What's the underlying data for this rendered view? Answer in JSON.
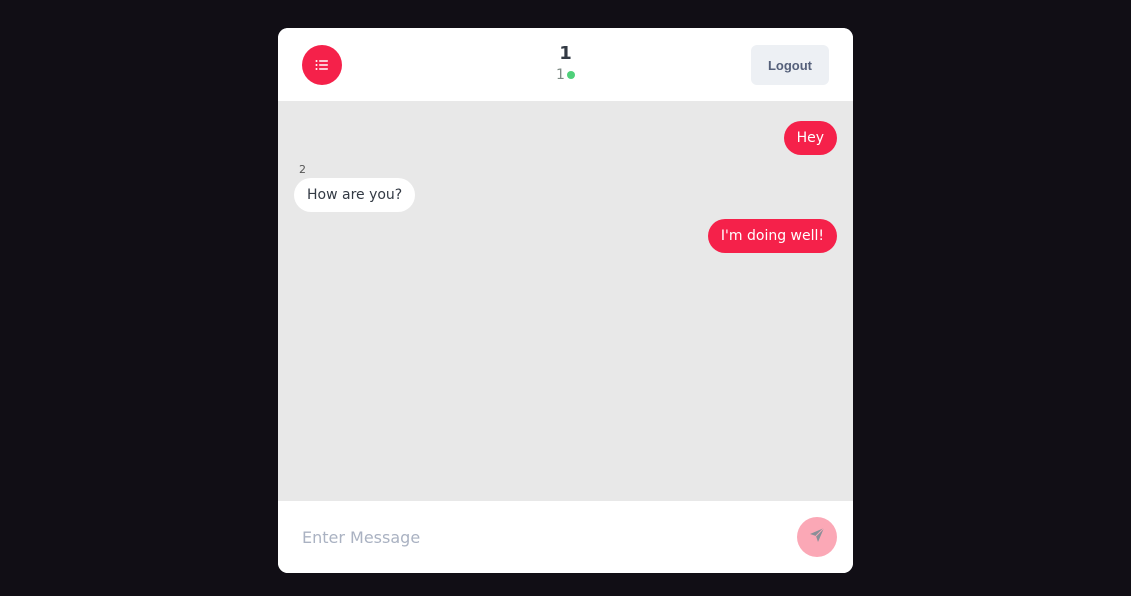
{
  "header": {
    "menu_icon": "list-icon",
    "room_name": "1",
    "online_count": "1",
    "logout_label": "Logout"
  },
  "messages": [
    {
      "text": "Hey",
      "mine": true
    },
    {
      "sender": "2",
      "text": "How are you?",
      "mine": false
    },
    {
      "text": "I'm doing well!",
      "mine": true
    }
  ],
  "composer": {
    "placeholder": "Enter Message",
    "value": "",
    "send_icon": "send-icon"
  },
  "colors": {
    "background": "#110e15",
    "accent": "#f5214a",
    "online": "#4fd07a",
    "message_area": "#e8e8e8"
  }
}
